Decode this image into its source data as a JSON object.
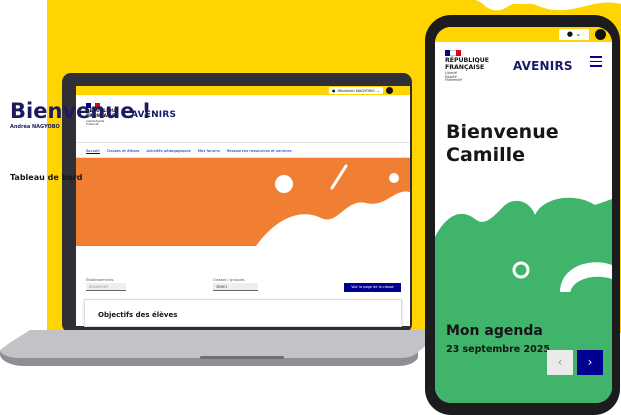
{
  "colors": {
    "yellow": "#ffd400",
    "orange": "#f07f33",
    "green": "#3fb46a",
    "navy": "#000091",
    "dark_navy": "#1b1b5e"
  },
  "laptop": {
    "user_menu": "Hibrahim NAGYOBO",
    "republic_line1": "RÉPUBLIQUE",
    "republic_line2": "FRANÇAISE",
    "motto": "Liberté Égalité Fraternité",
    "logo_text": "AVENIRS",
    "nav": [
      "Accueil",
      "Classes et élèves",
      "Activités pédagogiques",
      "Mes forums",
      "Ressources ressources et services"
    ],
    "hero_title": "Bienvenue !",
    "hero_subtitle": "Andréa NAGYOBO",
    "dashboard_title": "Tableau de bord",
    "school_label": "Établissements",
    "school_value": "BEAUMONT",
    "class_label": "Classes / groupes",
    "class_value": "3EME1",
    "class_button": "Voir la page de la classe",
    "card_title": "Objectifs des élèves"
  },
  "phone": {
    "republic_line1": "RÉPUBLIQUE",
    "republic_line2": "FRANÇAISE",
    "motto": "Liberté Égalité Fraternité",
    "logo_text": "AVENIRS",
    "welcome_line1": "Bienvenue",
    "welcome_line2": "Camille",
    "agenda_title": "Mon agenda",
    "agenda_date": "23 septembre 2025",
    "prev_icon": "‹",
    "next_icon": "›",
    "user_icon": "user-icon"
  }
}
